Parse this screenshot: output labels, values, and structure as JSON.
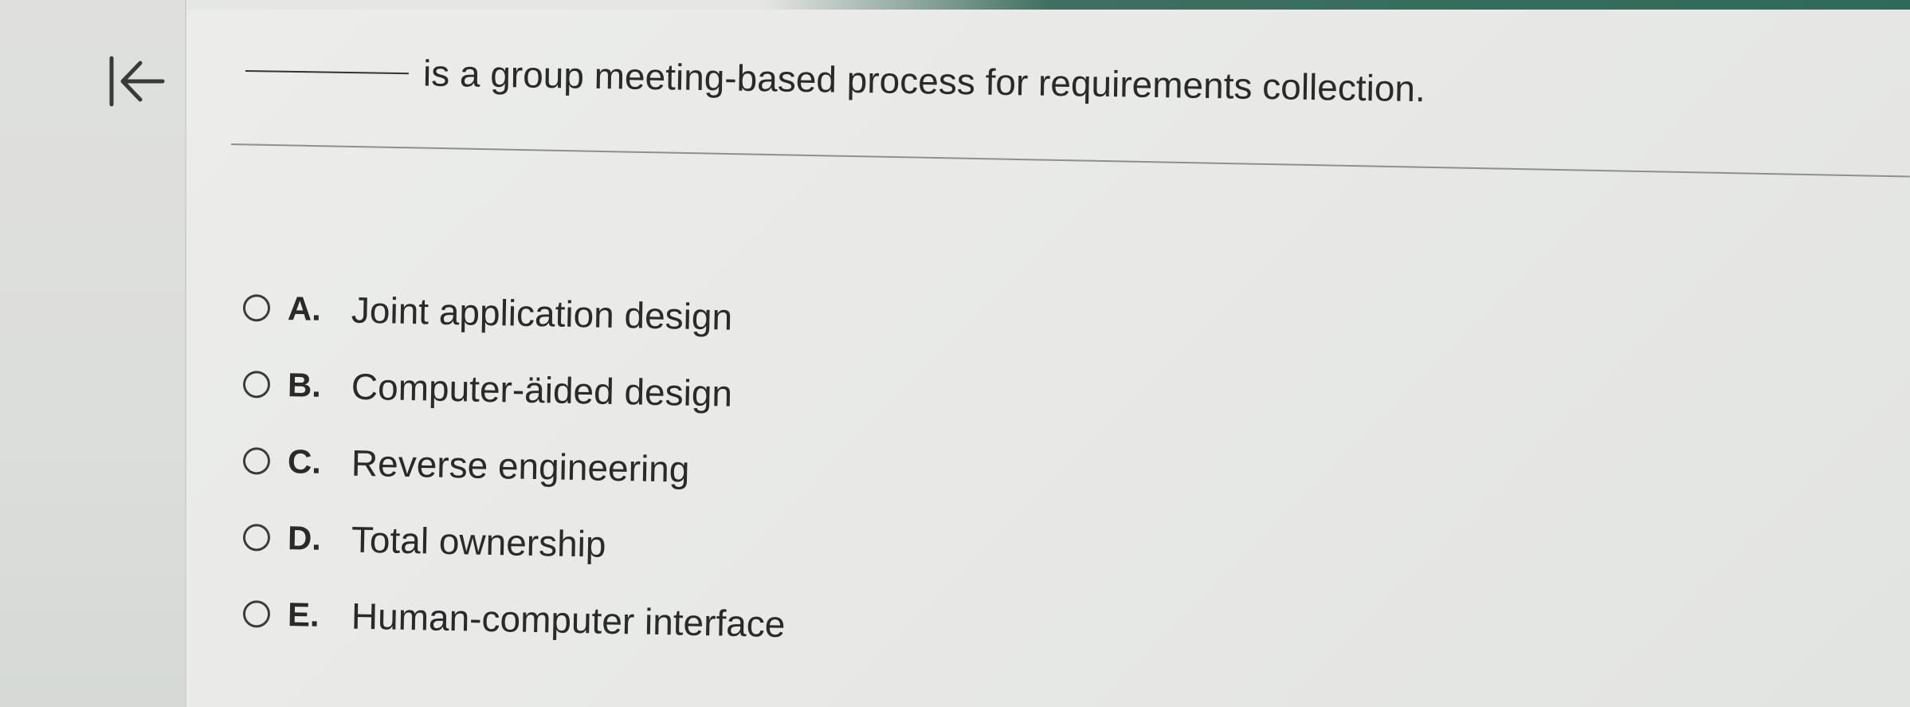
{
  "question": {
    "text": "is a group meeting-based process for requirements collection."
  },
  "nav": {
    "back_icon": "first-page-icon"
  },
  "options": [
    {
      "letter": "A.",
      "text": "Joint application design"
    },
    {
      "letter": "B.",
      "text": "Computer-äided design"
    },
    {
      "letter": "C.",
      "text": "Reverse engineering"
    },
    {
      "letter": "D.",
      "text": "Total ownership"
    },
    {
      "letter": "E.",
      "text": "Human-computer interface"
    }
  ]
}
